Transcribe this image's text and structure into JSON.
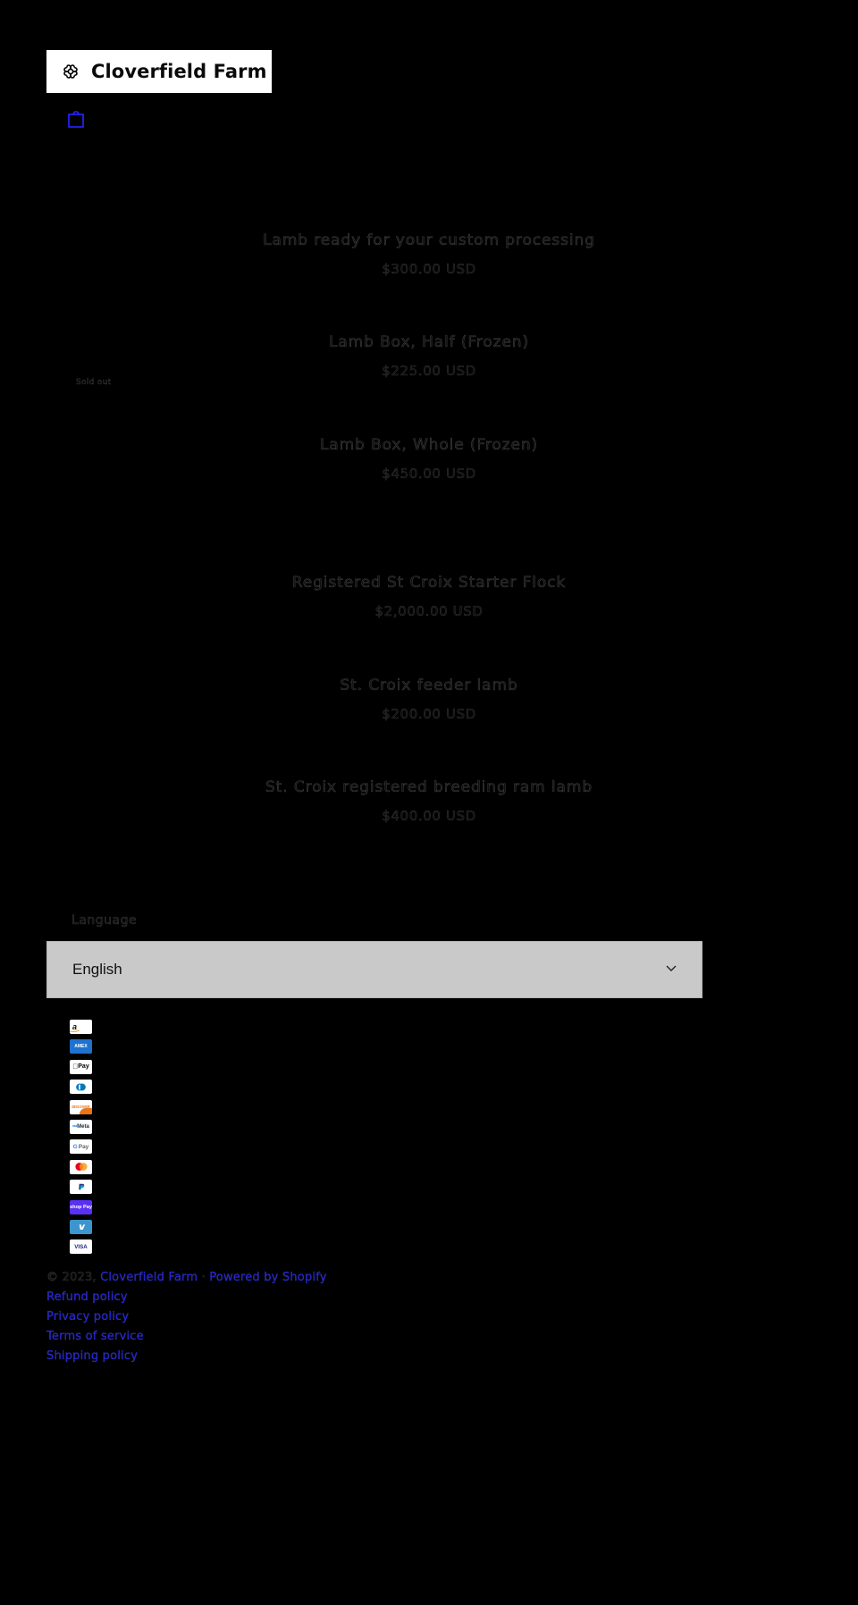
{
  "store": {
    "name": "Cloverfield Farm",
    "logo_icon": "clover-icon",
    "cart_icon": "shopping-bag-icon"
  },
  "products": [
    {
      "title": "Lamb ready for your custom processing",
      "price": "$300.00 USD",
      "badge": ""
    },
    {
      "title": "Lamb Box, Half (Frozen)",
      "price": "$225.00 USD",
      "badge": ""
    },
    {
      "title": "Lamb Box, Whole (Frozen)",
      "price": "$450.00 USD",
      "badge": "Sold out"
    },
    {
      "title": "Registered St Croix Starter Flock",
      "price": "$2,000.00 USD",
      "badge": ""
    },
    {
      "title": "St. Croix feeder lamb",
      "price": "$200.00 USD",
      "badge": ""
    },
    {
      "title": "St. Croix registered breeding ram lamb",
      "price": "$400.00 USD",
      "badge": ""
    }
  ],
  "language": {
    "label": "Language",
    "selected": "English",
    "chevron_icon": "chevron-down-icon"
  },
  "payments": [
    {
      "name": "amazon-pay-icon",
      "label": "a"
    },
    {
      "name": "american-express-icon",
      "label": "AMEX"
    },
    {
      "name": "apple-pay-icon",
      "label": "Pay"
    },
    {
      "name": "diners-club-icon",
      "label": ""
    },
    {
      "name": "discover-icon",
      "label": "DISCOVER"
    },
    {
      "name": "meta-pay-icon",
      "label": "Meta"
    },
    {
      "name": "google-pay-icon",
      "label": "G Pay"
    },
    {
      "name": "mastercard-icon",
      "label": ""
    },
    {
      "name": "paypal-icon",
      "label": "P"
    },
    {
      "name": "shop-pay-icon",
      "label": "shop Pay"
    },
    {
      "name": "venmo-icon",
      "label": "v"
    },
    {
      "name": "visa-icon",
      "label": "VISA"
    }
  ],
  "footer": {
    "copyright": "© 2023,",
    "store_link": "Cloverfield Farm",
    "separator": "·",
    "powered_by": "Powered by Shopify",
    "links": [
      "Refund policy",
      "Privacy policy",
      "Terms of service",
      "Shipping policy"
    ]
  }
}
